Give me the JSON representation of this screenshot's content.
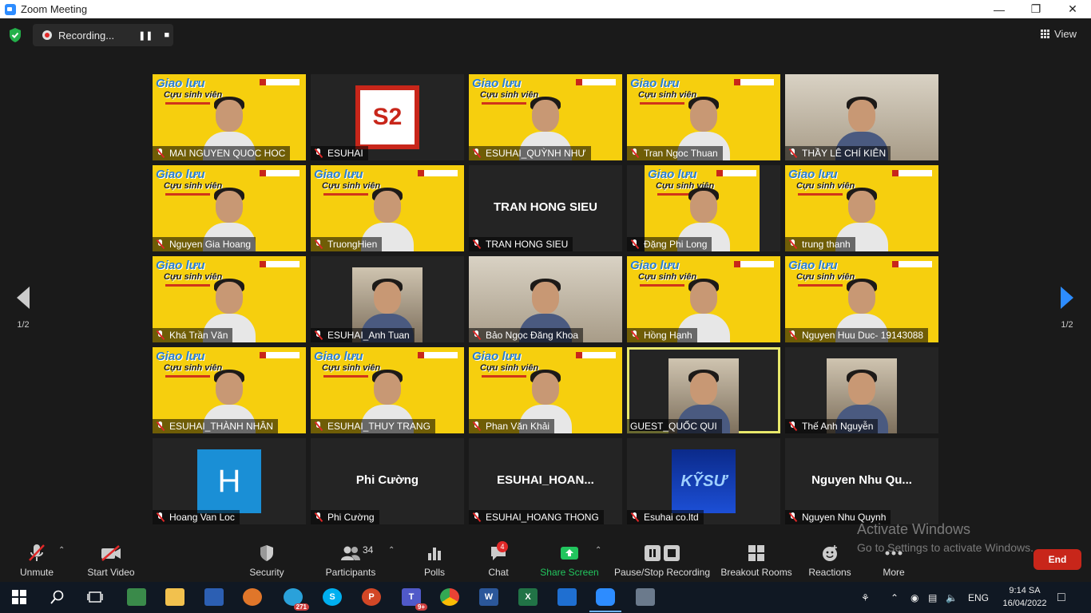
{
  "window": {
    "title": "Zoom Meeting"
  },
  "topbar": {
    "recording_label": "Recording...",
    "view_label": "View"
  },
  "nav": {
    "page_left": "1/2",
    "page_right": "1/2"
  },
  "tiles": [
    {
      "name": "MAI NGUYEN QUOC HOC",
      "kind": "banner"
    },
    {
      "name": "ESUHAI",
      "kind": "logo"
    },
    {
      "name": "ESUHAI_QUỲNH NHƯ",
      "kind": "banner"
    },
    {
      "name": "Tran Ngoc Thuan",
      "kind": "banner"
    },
    {
      "name": "THẦY LÊ CHÍ KIÊN",
      "kind": "room"
    },
    {
      "name": "Nguyen Gia Hoang",
      "kind": "banner"
    },
    {
      "name": "TruongHien",
      "kind": "banner"
    },
    {
      "name": "TRAN HONG SIEU",
      "kind": "text",
      "center": "TRAN HONG SIEU"
    },
    {
      "name": "Đặng Phi Long",
      "kind": "banner-small"
    },
    {
      "name": "trung thanh",
      "kind": "banner"
    },
    {
      "name": "Khá Trần Văn",
      "kind": "banner"
    },
    {
      "name": "ESUHAI_Anh Tuan",
      "kind": "room-small"
    },
    {
      "name": "Bảo Ngọc Đăng Khoa",
      "kind": "room"
    },
    {
      "name": "Hồng Hạnh",
      "kind": "banner"
    },
    {
      "name": "Nguyen Huu Duc- 19143088",
      "kind": "banner"
    },
    {
      "name": "ESUHAI_THÀNH NHÂN",
      "kind": "banner"
    },
    {
      "name": "ESUHAI_THUY TRANG",
      "kind": "banner"
    },
    {
      "name": "Phan Văn Khải",
      "kind": "banner"
    },
    {
      "name": "GUEST_QUỐC QUI",
      "kind": "room-small",
      "active": true
    },
    {
      "name": "Thế Anh Nguyễn",
      "kind": "room-small"
    },
    {
      "name": "Hoang Van Loc",
      "kind": "letter",
      "letter": "H"
    },
    {
      "name": "Phi Cường",
      "kind": "text",
      "center": "Phi Cường"
    },
    {
      "name": "ESUHAI_HOANG THONG",
      "kind": "text",
      "center": "ESUHAI_HOAN..."
    },
    {
      "name": "Esuhai co.ltd",
      "kind": "kysu"
    },
    {
      "name": "Nguyen Nhu Quynh",
      "kind": "text",
      "center": "Nguyen  Nhu  Qu..."
    }
  ],
  "banner_text": {
    "line1": "Giao lưu",
    "line2": "Cựu sinh viên"
  },
  "logo_text": "S2",
  "kysu_text": "KỸSƯ",
  "toolbar": {
    "unmute": "Unmute",
    "start_video": "Start Video",
    "security": "Security",
    "participants": "Participants",
    "participants_count": "34",
    "polls": "Polls",
    "chat": "Chat",
    "chat_badge": "4",
    "share_screen": "Share Screen",
    "recording": "Pause/Stop Recording",
    "breakout": "Breakout Rooms",
    "reactions": "Reactions",
    "more": "More",
    "end": "End"
  },
  "activation": {
    "line1": "Activate Windows",
    "line2": "Go to Settings to activate Windows."
  },
  "taskbar": {
    "telegram_badge": "271",
    "teams_badge": "9+",
    "lang": "ENG",
    "time": "9:14 SA",
    "date": "16/04/2022"
  },
  "colors": {
    "accent": "#2d8cff",
    "banner_yellow": "#f6cf0e",
    "end_red": "#c8261a",
    "active_outline": "#e8e86a",
    "share_green": "#22c55e"
  }
}
